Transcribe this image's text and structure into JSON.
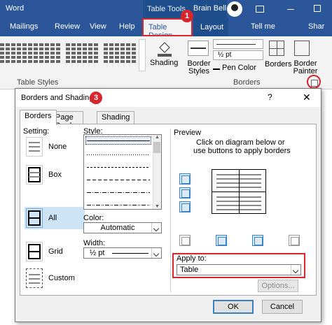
{
  "app": {
    "title": "Word",
    "context_tab_group": "Table Tools",
    "user": "Brain Bell"
  },
  "ribbon_tabs": [
    "Mailings",
    "Review",
    "View",
    "Help"
  ],
  "active_tab": "Table Design",
  "layout_tab": "Layout",
  "tell_me": "Tell me",
  "share": "Shar",
  "ribbon": {
    "shading": "Shading",
    "table_styles_group": "Table Styles",
    "border_styles_line1": "Border",
    "border_styles_line2": "Styles",
    "line_weight": "½ pt",
    "pen_color": "Pen Color",
    "borders": "Borders",
    "borders_group": "Borders",
    "border_painter_line1": "Border",
    "border_painter_line2": "Painter"
  },
  "callouts": {
    "one": "1",
    "two": "2",
    "three": "3"
  },
  "dialog": {
    "title": "Borders and Shading",
    "help": "?",
    "close": "✕",
    "tabs": [
      "Borders",
      "Page Border",
      "Shading"
    ],
    "setting_label": "Setting:",
    "settings": [
      "None",
      "Box",
      "All",
      "Grid",
      "Custom"
    ],
    "style_label": "Style:",
    "color_label": "Color:",
    "color_value": "Automatic",
    "width_label": "Width:",
    "width_value": "½ pt",
    "preview_label": "Preview",
    "preview_hint_1": "Click on diagram below or",
    "preview_hint_2": "use buttons to apply borders",
    "apply_label": "Apply to:",
    "apply_value": "Table",
    "options": "Options...",
    "ok": "OK",
    "cancel": "Cancel"
  },
  "colors": {
    "ribbon_blue": "#2b579a",
    "callout_red": "#d8262e",
    "selection_blue": "#cde4f7"
  }
}
